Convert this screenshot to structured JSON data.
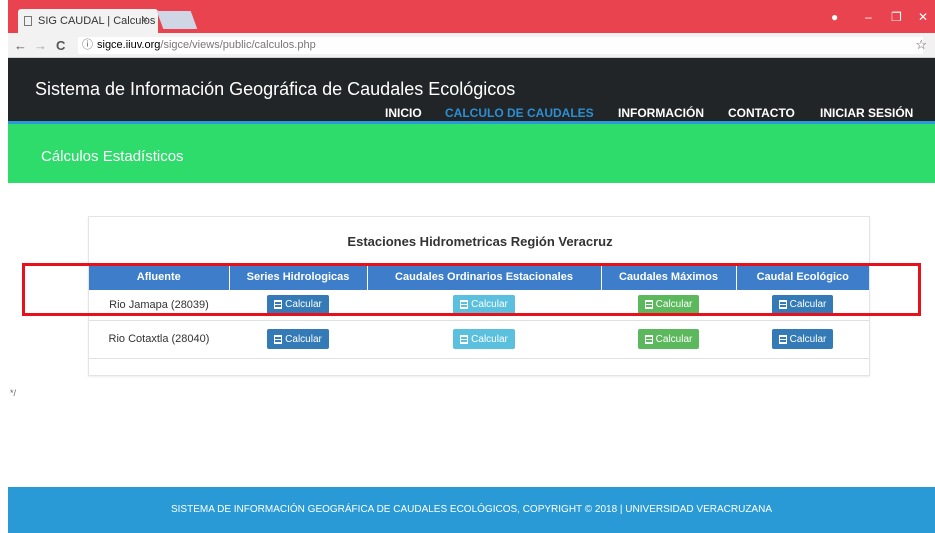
{
  "browser": {
    "tab_title": "SIG CAUDAL | Calculos",
    "tab_close": "×",
    "url_host": "sigce.iiuv.org",
    "url_path": "/sigce/views/public/calculos.php",
    "back": "←",
    "forward": "→",
    "reload": "C",
    "info": "ⓘ",
    "star": "☆",
    "profile": "●",
    "minimize": "–",
    "maximize": "❐",
    "close": "✕"
  },
  "site": {
    "title": "Sistema de Información Geográfica de Caudales Ecológicos",
    "nav": [
      {
        "label": "INICIO"
      },
      {
        "label": "CALCULO DE CAUDALES",
        "active": true
      },
      {
        "label": "INFORMACIÓN"
      },
      {
        "label": "CONTACTO"
      },
      {
        "label": "INICIAR SESIÓN"
      }
    ],
    "page_title": "Cálculos Estadísticos"
  },
  "panel": {
    "title": "Estaciones Hidrometricas Región Veracruz",
    "columns": [
      "Afluente",
      "Series Hidrologicas",
      "Caudales Ordinarios Estacionales",
      "Caudales Máximos",
      "Caudal Ecológico"
    ],
    "button_label": "Calcular",
    "rows": [
      {
        "afluente": "Rio Jamapa (28039)"
      },
      {
        "afluente": "Rio Cotaxtla (28040)"
      }
    ]
  },
  "stray_text": "*/",
  "footer": "SISTEMA DE INFORMACIÓN GEOGRÁFICA DE CAUDALES ECOLÓGICOS, COPYRIGHT © 2018 | UNIVERSIDAD VERACRUZANA",
  "colors": {
    "tabbar": "#e8434e",
    "header": "#222527",
    "green_band": "#2edc6c",
    "table_header": "#3d7dca",
    "btn_blue": "#337ab7",
    "btn_cyan": "#5bc0de",
    "btn_green": "#5cb85c",
    "footer": "#2a9ad6",
    "highlight": "#e8101a"
  }
}
